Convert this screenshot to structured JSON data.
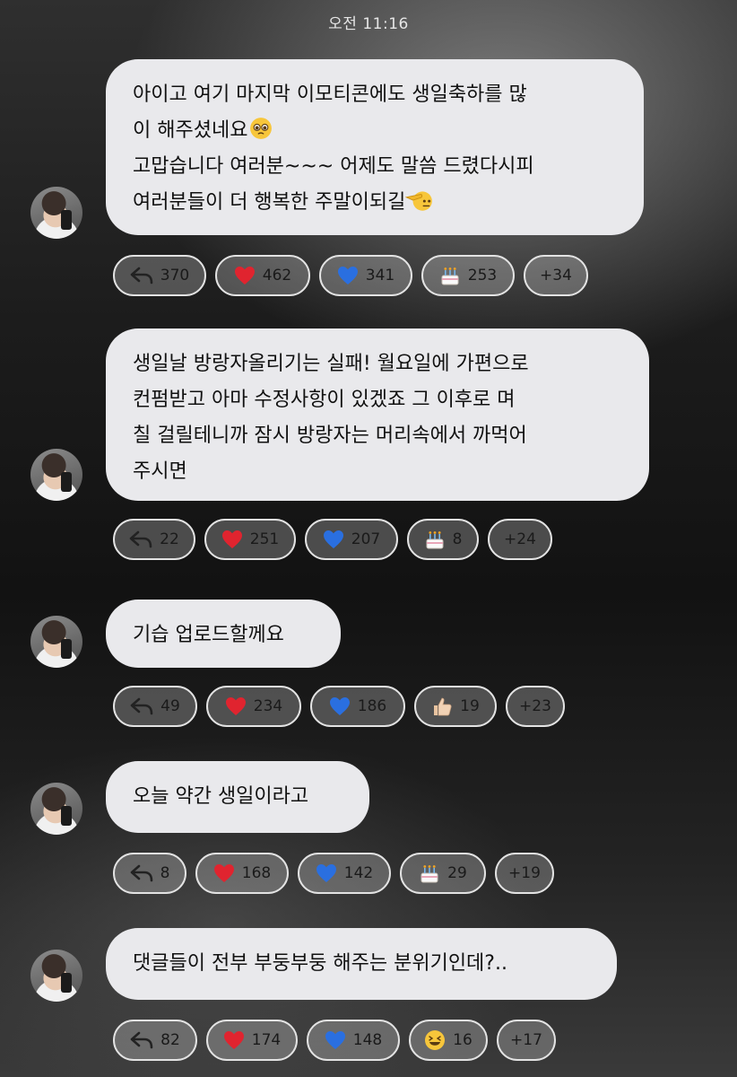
{
  "status_time": "오전 11:16",
  "messages": [
    {
      "text": "아이고 여기 마지막 이모티콘에도 생일축하를 많\n이 해주셨네요",
      "text2": "\n고맙습니다 여러분~~~ 어제도 말씀 드렸다시피\n여러분들이 더 행복한 주말이되길",
      "reactions": {
        "reply": "370",
        "heart": "462",
        "blue_heart": "341",
        "cake": "253",
        "more": "+34"
      }
    },
    {
      "text": "생일날 방랑자올리기는 실패! 월요일에 가편으로\n컨펌받고 아마 수정사항이 있겠죠 그 이후로 며\n칠 걸릴테니까 잠시 방랑자는 머리속에서 까먹어\n주시면",
      "reactions": {
        "reply": "22",
        "heart": "251",
        "blue_heart": "207",
        "cake": "8",
        "more": "+24"
      }
    },
    {
      "text": "기습 업로드할께요",
      "reactions": {
        "reply": "49",
        "heart": "234",
        "blue_heart": "186",
        "thumbs_up": "19",
        "more": "+23"
      }
    },
    {
      "text": "오늘 약간 생일이라고",
      "reactions": {
        "reply": "8",
        "heart": "168",
        "blue_heart": "142",
        "cake": "29",
        "more": "+19"
      }
    },
    {
      "text": "댓글들이 전부 부둥부둥 해주는 분위기인데?..",
      "reactions": {
        "reply": "82",
        "heart": "174",
        "blue_heart": "148",
        "laugh": "16",
        "more": "+17"
      }
    }
  ],
  "icons": {
    "reply": "reply-arrow-icon",
    "heart": "red-heart-icon",
    "blue_heart": "blue-heart-icon",
    "cake": "birthday-cake-icon",
    "thumbs_up": "thumbs-up-icon",
    "laugh": "laughing-face-icon",
    "pleading": "pleading-face-icon",
    "salute": "saluting-face-icon"
  },
  "colors": {
    "bubble": "#e9e9ec",
    "heart": "#e0242f",
    "blue_heart": "#2a6fe0"
  }
}
